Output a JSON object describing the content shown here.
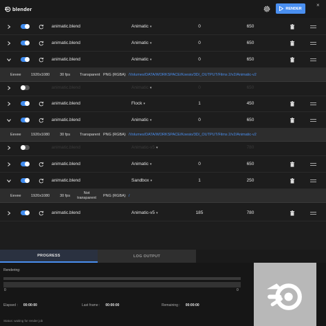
{
  "app": {
    "logo_text": "blender",
    "render_label": "RENDER",
    "close_symbol": "×",
    "icons": [
      "blender-logo-icon",
      "gear-icon",
      "play-icon",
      "close-icon",
      "chevron-right-icon",
      "chevron-down-icon",
      "reload-icon",
      "trash-icon",
      "menu-icon"
    ]
  },
  "rows": [
    {
      "expanded": false,
      "enabled": true,
      "file": "animatic.blend",
      "preset": "Animatic",
      "start": "0",
      "end": "650"
    },
    {
      "expanded": false,
      "enabled": true,
      "file": "animatic.blend",
      "preset": "Animatic",
      "start": "0",
      "end": "650"
    },
    {
      "expanded": true,
      "enabled": true,
      "file": "animatic.blend",
      "preset": "Animatic",
      "start": "0",
      "end": "650"
    },
    {
      "expanded": false,
      "enabled": false,
      "file": "animatic.blend",
      "preset": "Animatic",
      "start": "0",
      "end": "650"
    },
    {
      "expanded": false,
      "enabled": true,
      "file": "animatic.blend",
      "preset": "Flock",
      "start": "1",
      "end": "450"
    },
    {
      "expanded": true,
      "enabled": true,
      "file": "animatic.blend",
      "preset": "Animatic",
      "start": "0",
      "end": "650"
    },
    {
      "expanded": false,
      "enabled": false,
      "file": "animatic.blend",
      "preset": "Animatic-v5",
      "start": "",
      "end": "780"
    },
    {
      "expanded": false,
      "enabled": true,
      "file": "animatic.blend",
      "preset": "Animatic",
      "start": "0",
      "end": "650"
    },
    {
      "expanded": true,
      "enabled": true,
      "file": "animatic.blend",
      "preset": "Sandbox",
      "start": "1",
      "end": "250"
    },
    {
      "expanded": false,
      "enabled": true,
      "file": "animatic.blend",
      "preset": "Animatic-v5",
      "start": "185",
      "end": "780"
    }
  ],
  "details": [
    {
      "engine": "Eevee",
      "resolution": "1920x1080",
      "fps": "30 fps",
      "transparency": "Transparent",
      "format": "PNG (RGBA)",
      "path": "/Volumes/DATA/WORKSPACE/Koesio/3D/_OUTPUT/Films 2/v2/Animatic-v2"
    },
    {
      "engine": "Eevee",
      "resolution": "1920x1080",
      "fps": "30 fps",
      "transparency": "Transparent",
      "format": "PNG (RGBA)",
      "path": "/Volumes/DATA/WORKSPACE/Koesio/3D/_OUTPUT/Films 2/v2/Animatic-v2"
    },
    {
      "engine": "Eevee",
      "resolution": "1920x1080",
      "fps": "30 fps",
      "transparency": "Not transparent",
      "format": "PNG (RGBA)",
      "path": "/"
    }
  ],
  "tabs": {
    "progress": "PROGRESS",
    "log": "LOG OUTPUT"
  },
  "progress": {
    "rendering_label": "Rendering:",
    "min_label": "0",
    "max_label": "0",
    "value": 0,
    "elapsed_label": "Elapsed :",
    "elapsed_value": "00:00:00",
    "last_frame_label": "Last frame :",
    "last_frame_value": "00:00:00",
    "remaining_label": "Remaining :",
    "remaining_value": "00:00:00",
    "status": "Status: waiting for render job"
  },
  "colors": {
    "accent": "#4a8ff0",
    "background": "#1d1d1d",
    "details_bg": "#2d2d2d",
    "preview_bg": "#b8b8b8"
  }
}
